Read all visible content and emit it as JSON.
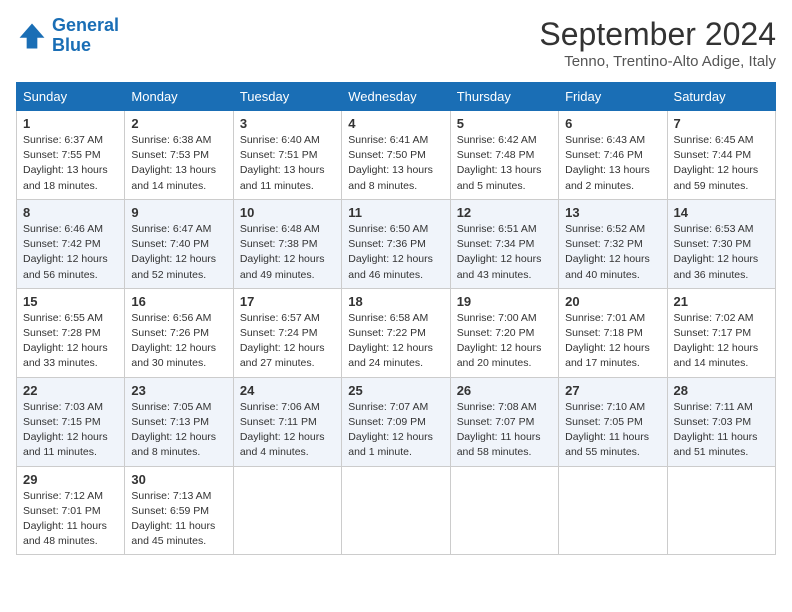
{
  "logo": {
    "line1": "General",
    "line2": "Blue"
  },
  "title": "September 2024",
  "location": "Tenno, Trentino-Alto Adige, Italy",
  "days_header": [
    "Sunday",
    "Monday",
    "Tuesday",
    "Wednesday",
    "Thursday",
    "Friday",
    "Saturday"
  ],
  "weeks": [
    [
      {
        "day": "1",
        "info": "Sunrise: 6:37 AM\nSunset: 7:55 PM\nDaylight: 13 hours and 18 minutes."
      },
      {
        "day": "2",
        "info": "Sunrise: 6:38 AM\nSunset: 7:53 PM\nDaylight: 13 hours and 14 minutes."
      },
      {
        "day": "3",
        "info": "Sunrise: 6:40 AM\nSunset: 7:51 PM\nDaylight: 13 hours and 11 minutes."
      },
      {
        "day": "4",
        "info": "Sunrise: 6:41 AM\nSunset: 7:50 PM\nDaylight: 13 hours and 8 minutes."
      },
      {
        "day": "5",
        "info": "Sunrise: 6:42 AM\nSunset: 7:48 PM\nDaylight: 13 hours and 5 minutes."
      },
      {
        "day": "6",
        "info": "Sunrise: 6:43 AM\nSunset: 7:46 PM\nDaylight: 13 hours and 2 minutes."
      },
      {
        "day": "7",
        "info": "Sunrise: 6:45 AM\nSunset: 7:44 PM\nDaylight: 12 hours and 59 minutes."
      }
    ],
    [
      {
        "day": "8",
        "info": "Sunrise: 6:46 AM\nSunset: 7:42 PM\nDaylight: 12 hours and 56 minutes."
      },
      {
        "day": "9",
        "info": "Sunrise: 6:47 AM\nSunset: 7:40 PM\nDaylight: 12 hours and 52 minutes."
      },
      {
        "day": "10",
        "info": "Sunrise: 6:48 AM\nSunset: 7:38 PM\nDaylight: 12 hours and 49 minutes."
      },
      {
        "day": "11",
        "info": "Sunrise: 6:50 AM\nSunset: 7:36 PM\nDaylight: 12 hours and 46 minutes."
      },
      {
        "day": "12",
        "info": "Sunrise: 6:51 AM\nSunset: 7:34 PM\nDaylight: 12 hours and 43 minutes."
      },
      {
        "day": "13",
        "info": "Sunrise: 6:52 AM\nSunset: 7:32 PM\nDaylight: 12 hours and 40 minutes."
      },
      {
        "day": "14",
        "info": "Sunrise: 6:53 AM\nSunset: 7:30 PM\nDaylight: 12 hours and 36 minutes."
      }
    ],
    [
      {
        "day": "15",
        "info": "Sunrise: 6:55 AM\nSunset: 7:28 PM\nDaylight: 12 hours and 33 minutes."
      },
      {
        "day": "16",
        "info": "Sunrise: 6:56 AM\nSunset: 7:26 PM\nDaylight: 12 hours and 30 minutes."
      },
      {
        "day": "17",
        "info": "Sunrise: 6:57 AM\nSunset: 7:24 PM\nDaylight: 12 hours and 27 minutes."
      },
      {
        "day": "18",
        "info": "Sunrise: 6:58 AM\nSunset: 7:22 PM\nDaylight: 12 hours and 24 minutes."
      },
      {
        "day": "19",
        "info": "Sunrise: 7:00 AM\nSunset: 7:20 PM\nDaylight: 12 hours and 20 minutes."
      },
      {
        "day": "20",
        "info": "Sunrise: 7:01 AM\nSunset: 7:18 PM\nDaylight: 12 hours and 17 minutes."
      },
      {
        "day": "21",
        "info": "Sunrise: 7:02 AM\nSunset: 7:17 PM\nDaylight: 12 hours and 14 minutes."
      }
    ],
    [
      {
        "day": "22",
        "info": "Sunrise: 7:03 AM\nSunset: 7:15 PM\nDaylight: 12 hours and 11 minutes."
      },
      {
        "day": "23",
        "info": "Sunrise: 7:05 AM\nSunset: 7:13 PM\nDaylight: 12 hours and 8 minutes."
      },
      {
        "day": "24",
        "info": "Sunrise: 7:06 AM\nSunset: 7:11 PM\nDaylight: 12 hours and 4 minutes."
      },
      {
        "day": "25",
        "info": "Sunrise: 7:07 AM\nSunset: 7:09 PM\nDaylight: 12 hours and 1 minute."
      },
      {
        "day": "26",
        "info": "Sunrise: 7:08 AM\nSunset: 7:07 PM\nDaylight: 11 hours and 58 minutes."
      },
      {
        "day": "27",
        "info": "Sunrise: 7:10 AM\nSunset: 7:05 PM\nDaylight: 11 hours and 55 minutes."
      },
      {
        "day": "28",
        "info": "Sunrise: 7:11 AM\nSunset: 7:03 PM\nDaylight: 11 hours and 51 minutes."
      }
    ],
    [
      {
        "day": "29",
        "info": "Sunrise: 7:12 AM\nSunset: 7:01 PM\nDaylight: 11 hours and 48 minutes."
      },
      {
        "day": "30",
        "info": "Sunrise: 7:13 AM\nSunset: 6:59 PM\nDaylight: 11 hours and 45 minutes."
      },
      null,
      null,
      null,
      null,
      null
    ]
  ]
}
